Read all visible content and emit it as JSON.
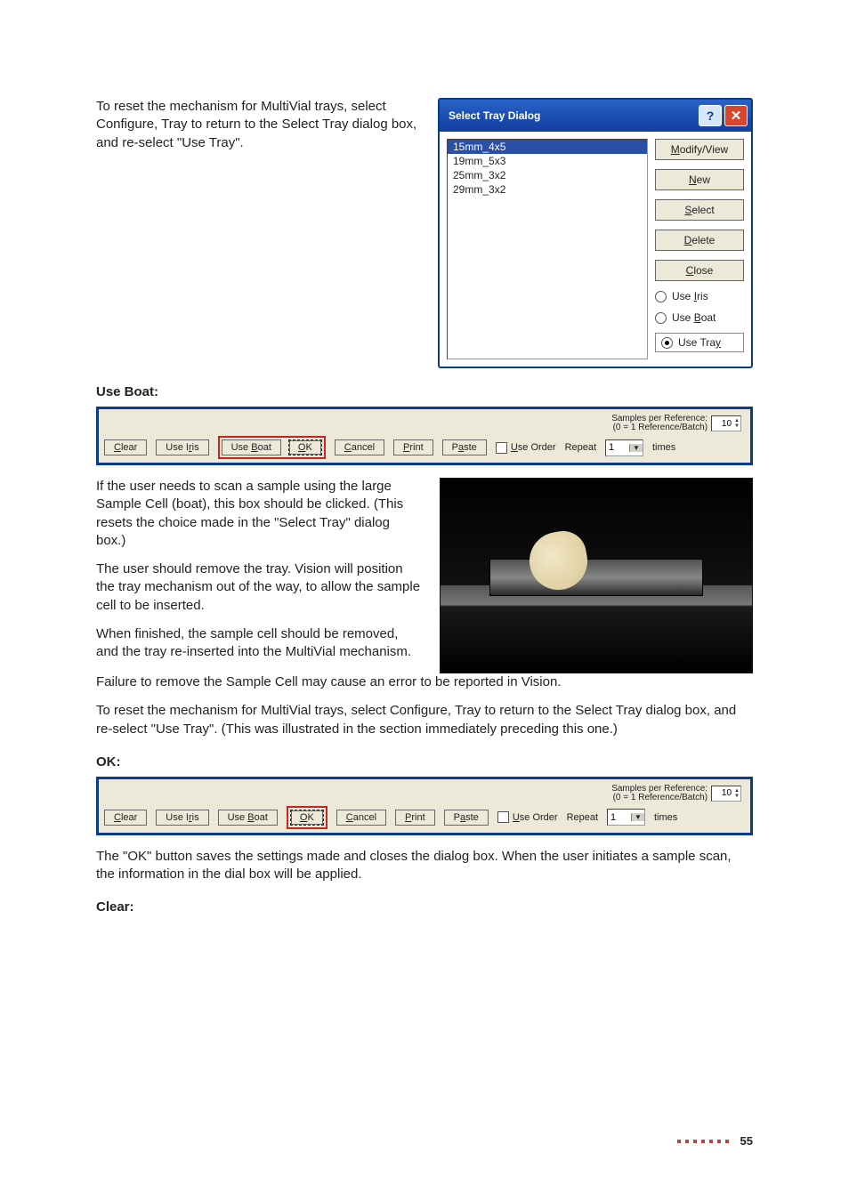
{
  "intro_para": "To reset the mechanism for MultiVial trays, select Configure, Tray to return to the Select Tray dialog box, and re-select \"Use Tray\".",
  "tray_dialog": {
    "title": "Select Tray Dialog",
    "help_glyph": "?",
    "close_glyph": "✕",
    "items": [
      "15mm_4x5",
      "19mm_5x3",
      "25mm_3x2",
      "29mm_3x2"
    ],
    "selected_index": 0,
    "buttons": {
      "modify": {
        "pre": "M",
        "rest": "odify/View"
      },
      "new": {
        "pre": "N",
        "rest": "ew"
      },
      "select": {
        "pre": "S",
        "rest": "elect"
      },
      "delete": {
        "pre": "D",
        "rest": "elete"
      },
      "close": {
        "pre": "C",
        "rest": "lose"
      }
    },
    "radios": {
      "iris": {
        "prefix": "Use ",
        "u": "I",
        "suffix": "ris"
      },
      "boat": {
        "prefix": "Use ",
        "u": "B",
        "suffix": "oat"
      },
      "tray": {
        "prefix": "Use Tra",
        "u": "y",
        "suffix": ""
      }
    }
  },
  "use_boat_heading": "Use Boat:",
  "toolbar": {
    "spr_label": "Samples per Reference:",
    "spr_sub": "(0 = 1 Reference/Batch)",
    "spr_value": "10",
    "clear": {
      "u": "C",
      "rest": "lear"
    },
    "useiris": {
      "prefix": "Use I",
      "u": "r",
      "suffix": "is"
    },
    "useboat": {
      "prefix": "Use ",
      "u": "B",
      "suffix": "oat"
    },
    "ok": {
      "u": "O",
      "rest": "K"
    },
    "cancel": {
      "u": "C",
      "rest": "ancel"
    },
    "print": {
      "u": "P",
      "rest": "rint"
    },
    "paste": {
      "prefix": "P",
      "u": "a",
      "suffix": "ste"
    },
    "useorder": {
      "u": "U",
      "rest": "se Order"
    },
    "repeat_label": "Repeat",
    "repeat_value": "1",
    "times_label": "times"
  },
  "boat_p1": "If the user needs to scan a sample using the large Sample Cell (boat), this box should be clicked. (This resets the choice made in the \"Select Tray\" dialog box.)",
  "boat_p2": "The user should remove the tray. Vision will position the tray mechanism out of the way, to allow the sample cell to be inserted.",
  "boat_p3": "When finished, the sample cell should be removed, and the tray re-inserted into the MultiVial mechanism.",
  "boat_p4": "Failure to remove the Sample Cell may cause an error to be reported in Vision.",
  "boat_p5": "To reset the mechanism for MultiVial trays, select Configure, Tray to return to the Select Tray dialog box, and re-select \"Use Tray\". (This was illustrated in the section immediately preceding this one.)",
  "ok_heading": "OK:",
  "ok_para": "The \"OK\" button saves the settings made and closes the dialog box. When the user initiates a sample scan, the information in the dial box will be applied.",
  "clear_heading": "Clear:",
  "page_number": "55"
}
